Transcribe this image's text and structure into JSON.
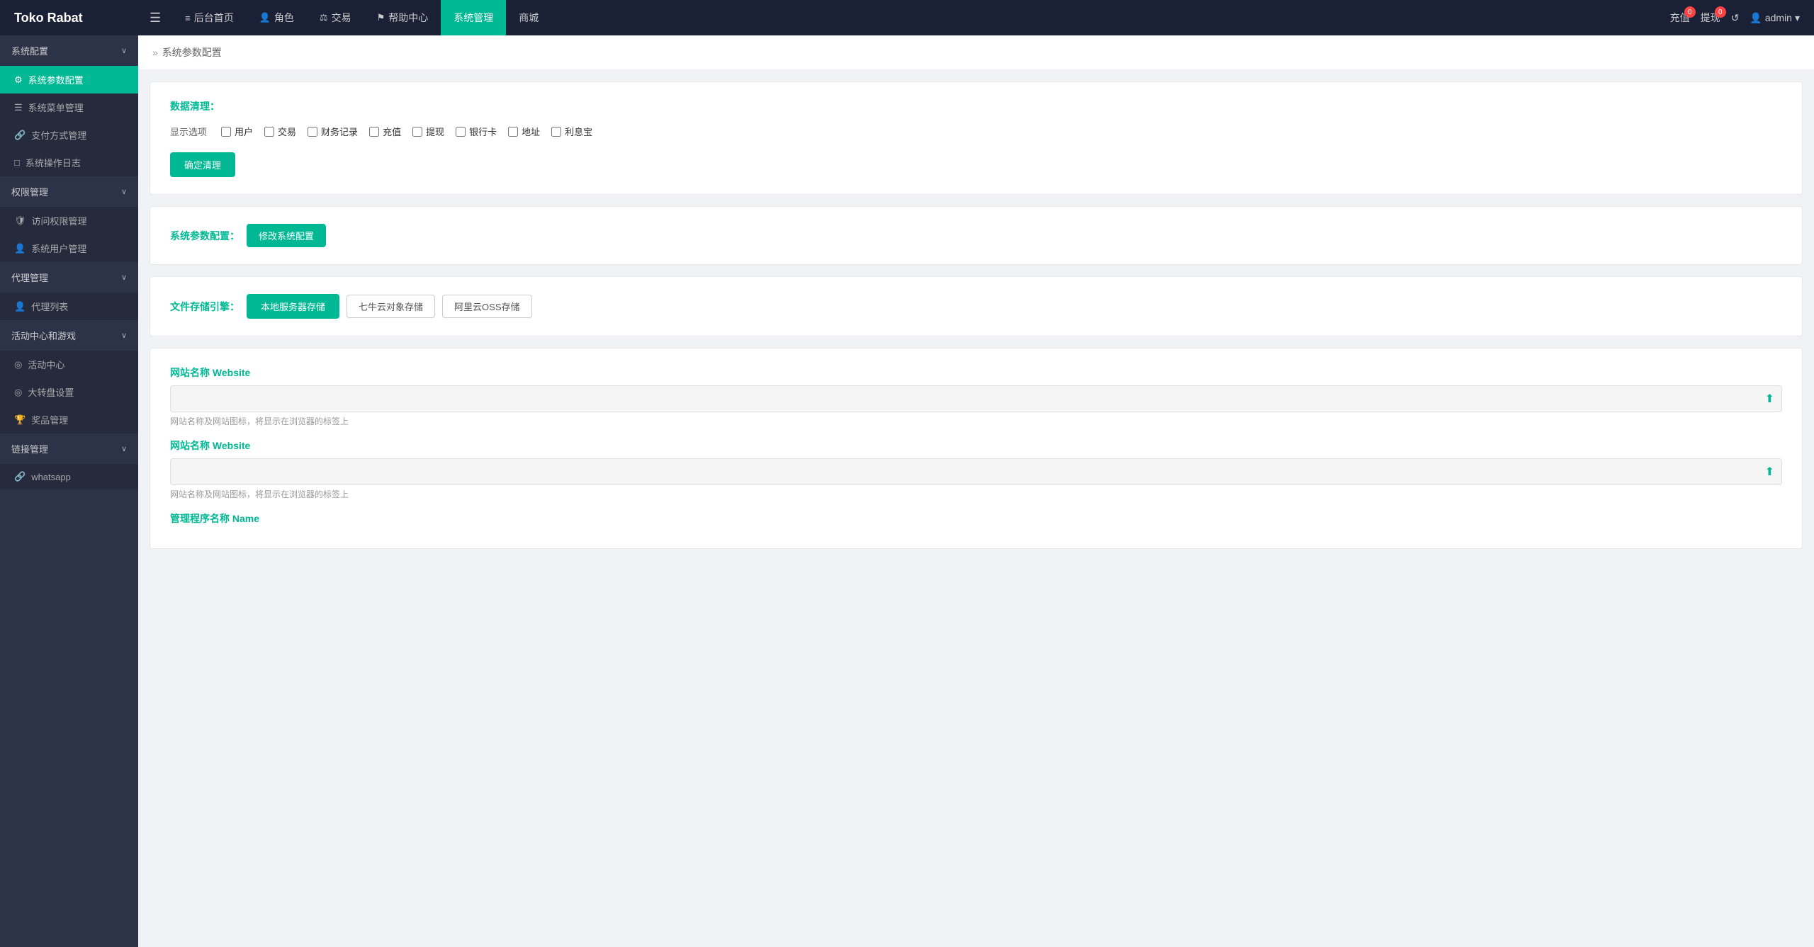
{
  "brand": "Toko Rabat",
  "topNav": {
    "menuIcon": "☰",
    "items": [
      {
        "label": "后台首页",
        "icon": "≡",
        "active": false
      },
      {
        "label": "角色",
        "icon": "👤",
        "active": false
      },
      {
        "label": "交易",
        "icon": "⚖",
        "active": false
      },
      {
        "label": "帮助中心",
        "icon": "⚑",
        "active": false
      },
      {
        "label": "系统管理",
        "icon": "",
        "active": true
      },
      {
        "label": "商城",
        "icon": "",
        "active": false
      }
    ],
    "recharge": {
      "label": "充值",
      "badge": "0"
    },
    "withdraw": {
      "label": "提现",
      "badge": "0"
    },
    "refresh": "↺",
    "user": "admin"
  },
  "sidebar": {
    "sections": [
      {
        "title": "系统配置",
        "expanded": true,
        "items": [
          {
            "label": "系统参数配置",
            "icon": "⚙",
            "active": true
          },
          {
            "label": "系统菜单管理",
            "icon": "☰",
            "active": false
          },
          {
            "label": "支付方式管理",
            "icon": "🔗",
            "active": false
          },
          {
            "label": "系统操作日志",
            "icon": "□",
            "active": false
          }
        ]
      },
      {
        "title": "权限管理",
        "expanded": true,
        "items": [
          {
            "label": "访问权限管理",
            "icon": "🛡",
            "active": false
          },
          {
            "label": "系统用户管理",
            "icon": "👤",
            "active": false
          }
        ]
      },
      {
        "title": "代理管理",
        "expanded": true,
        "items": [
          {
            "label": "代理列表",
            "icon": "👤",
            "active": false
          }
        ]
      },
      {
        "title": "活动中心和游戏",
        "expanded": true,
        "items": [
          {
            "label": "活动中心",
            "icon": "◎",
            "active": false
          },
          {
            "label": "大转盘设置",
            "icon": "◎",
            "active": false
          },
          {
            "label": "奖品管理",
            "icon": "🏆",
            "active": false
          }
        ]
      },
      {
        "title": "链接管理",
        "expanded": true,
        "items": [
          {
            "label": "whatsapp",
            "icon": "🔗",
            "active": false
          }
        ]
      }
    ]
  },
  "breadcrumb": {
    "separator": "»",
    "current": "系统参数配置"
  },
  "dataClean": {
    "sectionTitle": "数据清理：",
    "displayLabel": "显示选项",
    "checkboxes": [
      "用户",
      "交易",
      "财务记录",
      "充值",
      "提现",
      "银行卡",
      "地址",
      "利息宝"
    ],
    "confirmButton": "确定清理"
  },
  "systemConfig": {
    "sectionTitle": "系统参数配置：",
    "modifyButton": "修改系统配置"
  },
  "fileStorage": {
    "sectionTitle": "文件存储引擎：",
    "buttons": [
      "本地服务器存储",
      "七牛云对象存储",
      "阿里云OSS存储"
    ]
  },
  "websiteConfig": {
    "fields": [
      {
        "label": "网站名称 Website",
        "value": "",
        "hint": "网站名称及网站图标，将显示在浏览器的标签上"
      },
      {
        "label": "网站名称 Website",
        "value": "",
        "hint": "网站名称及网站图标，将显示在浏览器的标签上"
      },
      {
        "label": "管理程序名称 Name",
        "value": "",
        "hint": ""
      }
    ]
  }
}
